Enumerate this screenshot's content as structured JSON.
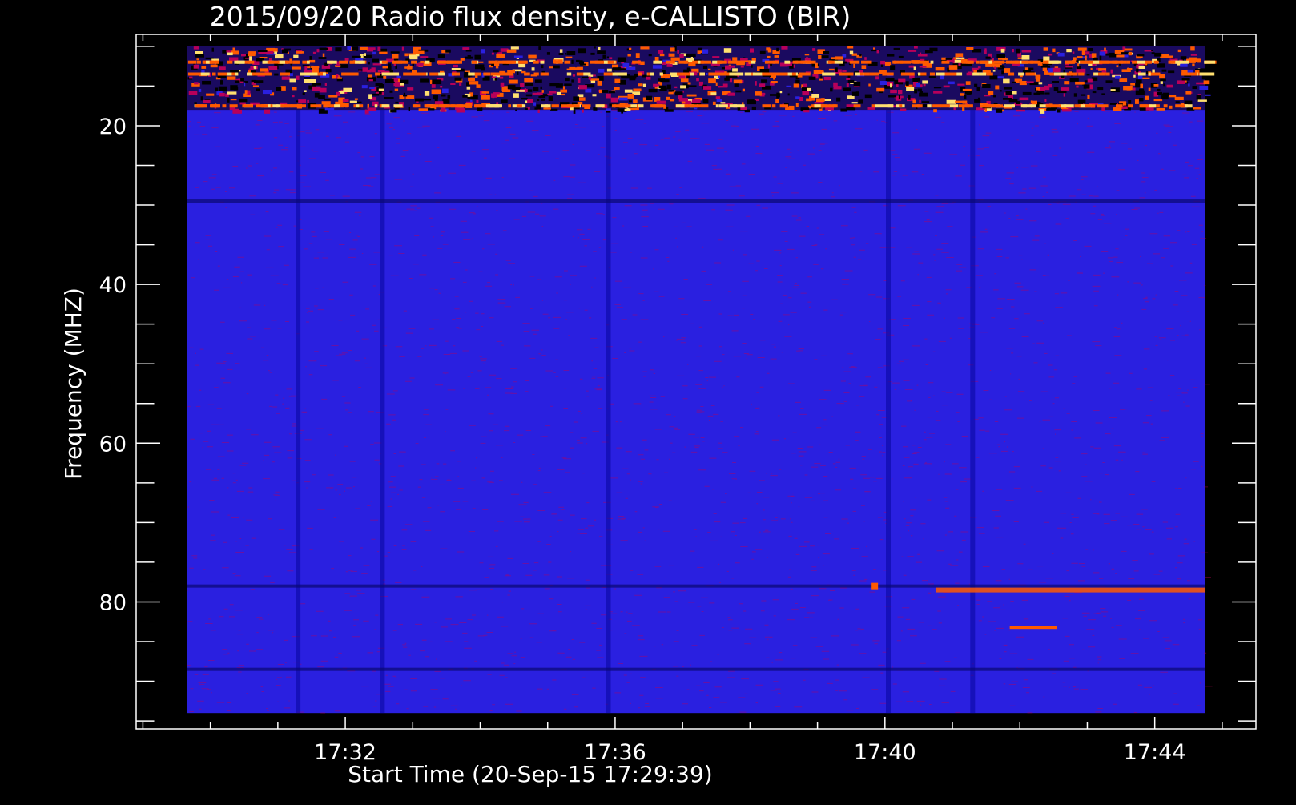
{
  "chart_data": {
    "type": "heatmap",
    "title": "2015/09/20  Radio flux density, e-CALLISTO (BIR)",
    "xlabel": "Start Time (20-Sep-15 17:29:39)",
    "ylabel": "Frequency (MHZ)",
    "x_unit": "minutes past 17:00",
    "x_range": [
      29.66,
      44.75
    ],
    "y_range": [
      10,
      94
    ],
    "ylim": [
      8.5,
      96
    ],
    "xlim": [
      28.9,
      45.5
    ],
    "y_inverted": true,
    "x_ticks": [
      {
        "value": 32,
        "label": "17:32"
      },
      {
        "value": 36,
        "label": "17:36"
      },
      {
        "value": 40,
        "label": "17:40"
      },
      {
        "value": 44,
        "label": "17:44"
      }
    ],
    "y_ticks": [
      {
        "value": 20,
        "label": "20"
      },
      {
        "value": 40,
        "label": "40"
      },
      {
        "value": 60,
        "label": "60"
      },
      {
        "value": 80,
        "label": "80"
      }
    ],
    "x_minor_step": 1,
    "y_minor_step": 5,
    "colors": {
      "background": "#2a20e0",
      "low": "#000000",
      "mid": "#b8005a",
      "high": "#ff5a00",
      "peak": "#ffe070",
      "axis": "#ffffff"
    },
    "features": {
      "rfi_band_mhz": [
        10,
        18
      ],
      "bright_rows_mhz": [
        12,
        13.5,
        17.5
      ],
      "emission_line_80mhz": {
        "freq": 78.5,
        "t_start": 40.75,
        "t_end": 44.75
      },
      "emission_line_84mhz": {
        "freq": 83.2,
        "t_start": 41.85,
        "t_end": 42.55
      },
      "spot": {
        "time": 39.85,
        "freq": 78
      }
    }
  }
}
